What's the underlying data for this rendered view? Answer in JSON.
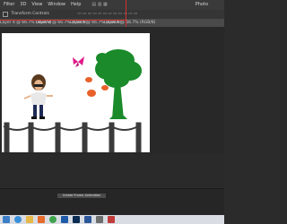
{
  "menubar": {
    "app_logo": "Ps",
    "items": [
      "Filter",
      "3D",
      "View",
      "Window",
      "Help"
    ],
    "right_label": "Photo"
  },
  "options_bar": {
    "label": "Transform Controls"
  },
  "tabs": [
    {
      "label": "Layer 4 @ 66.7% (RGB/8)"
    },
    {
      "label": "Layer 4 @ 66.7% (RGB/8)"
    },
    {
      "label": "Layer 4 @ 66.7% (RGB/8)"
    },
    {
      "label": "Layer 4 @ 66.7% (RGB/8)"
    }
  ],
  "timeline": {
    "create_button": "Create Frame Animation"
  },
  "colors": {
    "tree": "#1a8a2a",
    "butterfly": "#e01a8a",
    "leaves": "#e8612a",
    "fence": "#3b3b3b",
    "highlight": "#d23030"
  }
}
